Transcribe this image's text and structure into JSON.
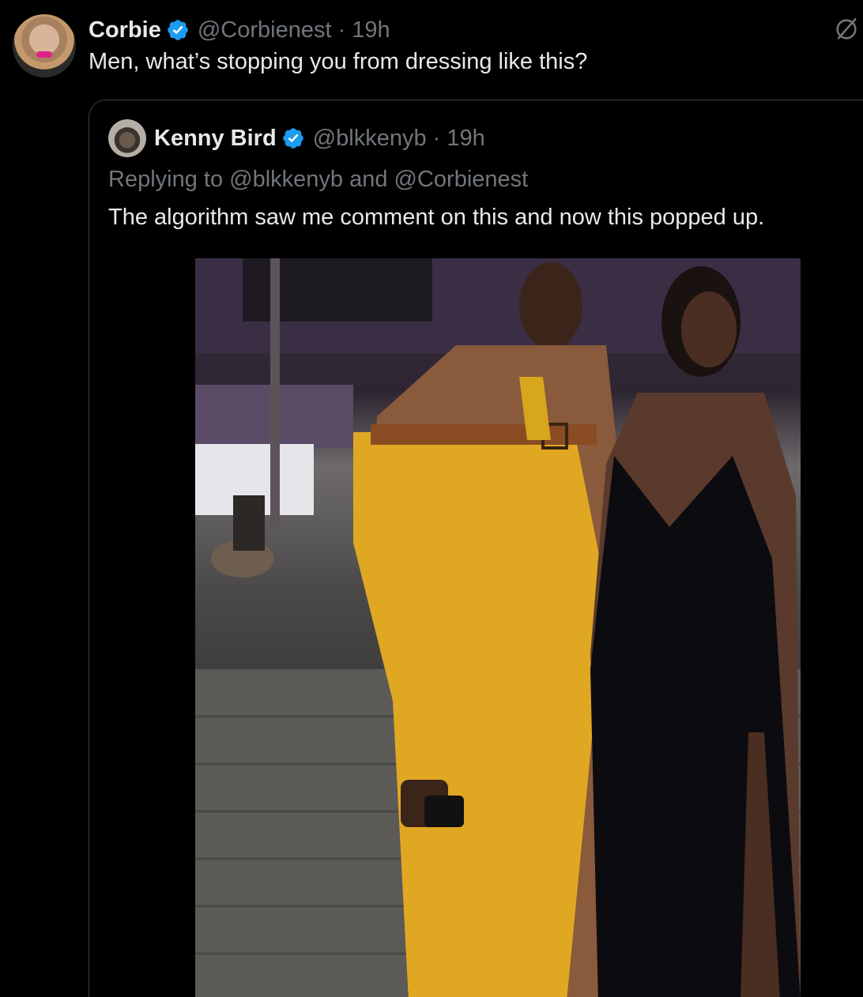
{
  "tweet": {
    "author_name": "Corbie",
    "author_handle": "@Corbienest · 19h",
    "text": "Men, what’s stopping you from dressing like this?"
  },
  "quote": {
    "author_name": "Kenny Bird",
    "author_handle": "@blkkenyb · 19h",
    "replying_to": "Replying to @blkkenyb and @Corbienest",
    "text": "The algorithm saw me comment on this and now this popped up."
  },
  "icons": {
    "verified": "verified-badge-icon",
    "grok": "grok-icon"
  },
  "colors": {
    "background": "#000000",
    "text_primary": "#e7e9ea",
    "text_secondary": "#71767b",
    "verified_blue": "#1d9bf0",
    "border": "#3a3d40"
  }
}
